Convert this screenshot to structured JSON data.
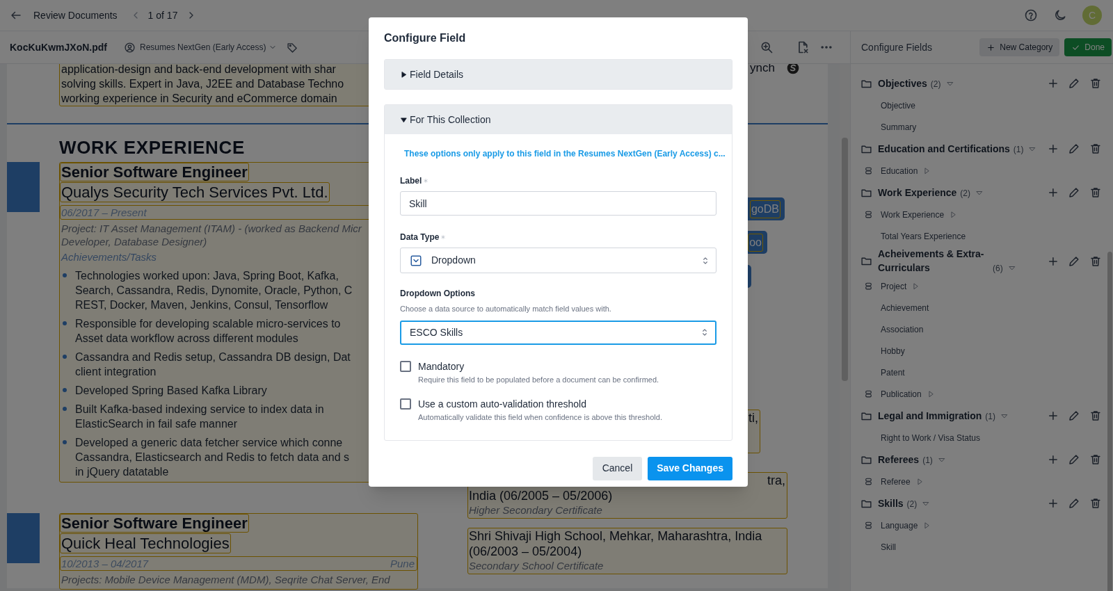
{
  "top_bar": {
    "title": "Review Documents",
    "pager": "1 of 17",
    "avatar": "C"
  },
  "doc_bar": {
    "filename": "KocKuKwmJXoN.pdf",
    "collection": "Resumes NextGen (Early Access)"
  },
  "document": {
    "summary_lines": [
      "application-design and back-end development with shar",
      "solving skills. Expert in Java, J2EE and Database Techno",
      "working experience in Security and eCommerce domain"
    ],
    "section_heading": "WORK EXPERIENCE",
    "jobs": [
      {
        "title": "Senior Software Engineer",
        "company": "Qualys Security Tech Services Pvt. Ltd.",
        "dates": "06/2017 – Present",
        "project_lines": [
          "Project: IT Asset Management (ITAM) - (worked as Backend Micr",
          "Developer, Database Designer)"
        ],
        "tasks_heading": "Achievements/Tasks",
        "bullets": [
          [
            "Technologies worked upon: Java, Spring Boot, Kafka,",
            "Search, Cassandra, Redis, Dynomite, Oracle, Python, C",
            "REST, Docker, Maven, Jenkins, Consul, Tensorflow"
          ],
          [
            "Responsible for developing scalable micro-services to",
            "Asset data workflow across different modules"
          ],
          [
            "Cassandra and Redis setup, Cassandra DB design, Dat",
            "client integration"
          ],
          [
            "Developed Spring Based Kafka Library"
          ],
          [
            "Built Kafka-based indexing service to index data in",
            "ElasticSearch in fail safe manner"
          ],
          [
            "Developed a generic data fetcher service which conne",
            "Cassandra, Elasticsearch and Redis to fetch data and s",
            "in jQuery datatable"
          ]
        ]
      },
      {
        "title": "Senior Software Engineer",
        "company": "Quick Heal Technologies",
        "dates": "10/2013 – 04/2017",
        "location": "Pune",
        "project_lines": [
          "Projects: Mobile Device Management (MDM), Seqrite Chat Server, End"
        ]
      }
    ],
    "contact_fragment": "ynch",
    "skill_chips": [
      {
        "kind": "text",
        "text": "goDB"
      },
      {
        "kind": "text",
        "text": "oo"
      },
      {
        "kind": "blank"
      }
    ],
    "education_fragment": "ti,",
    "education": [
      {
        "fragment": "tra,",
        "lines": [
          "India (06/2005 – 05/2006)"
        ],
        "certificate": "Higher Secondary Certificate"
      },
      {
        "lines": [
          "Shri Shivaji High School, Mehkar, Maharashtra, India",
          "(06/2003 – 05/2004)"
        ],
        "certificate": "Secondary School Certificate"
      }
    ]
  },
  "panel": {
    "title": "Configure Fields",
    "new_button": "New Category",
    "done_button": "Done",
    "categories": [
      {
        "name": "Objectives",
        "count": "(2)",
        "expanded": true,
        "children": [
          {
            "kind": "field",
            "name": "Objective"
          },
          {
            "kind": "field",
            "name": "Summary"
          }
        ]
      },
      {
        "name": "Education and Certifications",
        "count": "(1)",
        "expanded": true,
        "children": [
          {
            "kind": "group",
            "name": "Education"
          }
        ]
      },
      {
        "name": "Work Experience",
        "count": "(2)",
        "expanded": true,
        "children": [
          {
            "kind": "group",
            "name": "Work Experience"
          },
          {
            "kind": "field",
            "name": "Total Years Experience"
          }
        ]
      },
      {
        "name": "Acheivements & Extra-Curriculars",
        "count": "(6)",
        "expanded": true,
        "children": [
          {
            "kind": "group",
            "name": "Project"
          },
          {
            "kind": "field",
            "name": "Achievement"
          },
          {
            "kind": "field",
            "name": "Association"
          },
          {
            "kind": "field",
            "name": "Hobby"
          },
          {
            "kind": "field",
            "name": "Patent"
          },
          {
            "kind": "group",
            "name": "Publication"
          }
        ]
      },
      {
        "name": "Legal and Immigration",
        "count": "(1)",
        "expanded": true,
        "children": [
          {
            "kind": "field",
            "name": "Right to Work / Visa Status"
          }
        ]
      },
      {
        "name": "Referees",
        "count": "(1)",
        "expanded": true,
        "children": [
          {
            "kind": "group",
            "name": "Referee"
          }
        ]
      },
      {
        "name": "Skills",
        "count": "(2)",
        "expanded": true,
        "children": [
          {
            "kind": "group",
            "name": "Language"
          },
          {
            "kind": "field",
            "name": "Skill"
          }
        ]
      }
    ]
  },
  "dialog": {
    "title": "Configure Field",
    "sections": [
      {
        "title": "Field Details",
        "expanded": false
      },
      {
        "title": "For This Collection",
        "expanded": true
      }
    ],
    "info": "These options only apply to this field in the Resumes NextGen (Early Access) c...",
    "label_field": {
      "label": "Label",
      "required": true,
      "value": "Skill"
    },
    "data_type": {
      "label": "Data Type",
      "required": true,
      "value": "Dropdown"
    },
    "dropdown_options": {
      "label": "Dropdown Options",
      "hint": "Choose a data source to automatically match field values with.",
      "value": "ESCO Skills",
      "focused": true
    },
    "checkboxes": [
      {
        "label": "Mandatory",
        "hint": "Require this field to be populated before a document can be confirmed.",
        "checked": false
      },
      {
        "label": "Use a custom auto-validation threshold",
        "hint": "Automatically validate this field when confidence is above this threshold.",
        "checked": false
      }
    ],
    "buttons": [
      {
        "label": "Cancel",
        "kind": "secondary"
      },
      {
        "label": "Save Changes",
        "kind": "primary"
      }
    ]
  }
}
